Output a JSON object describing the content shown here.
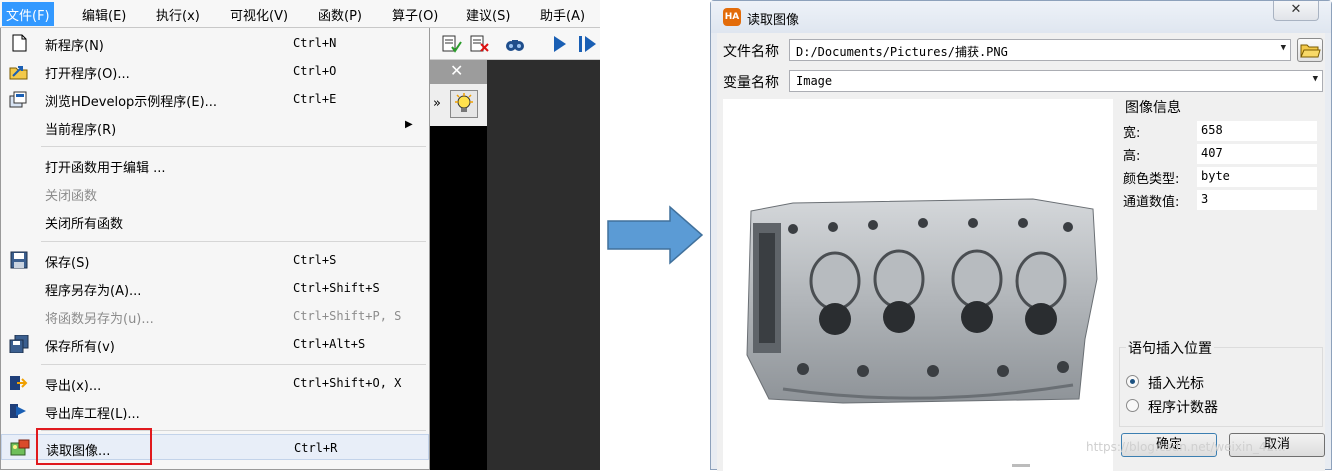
{
  "menubar": {
    "items": [
      "文件(F)",
      "编辑(E)",
      "执行(x)",
      "可视化(V)",
      "函数(P)",
      "算子(O)",
      "建议(S)",
      "助手(A)"
    ]
  },
  "file_menu": {
    "items": [
      {
        "label": "新程序(N)",
        "shortcut": "Ctrl+N",
        "icon": "new-file-icon"
      },
      {
        "label": "打开程序(O)...",
        "shortcut": "Ctrl+O",
        "icon": "open-program-icon"
      },
      {
        "label": "浏览HDevelop示例程序(E)...",
        "shortcut": "Ctrl+E",
        "icon": "browse-examples-icon"
      },
      {
        "label": "当前程序(R)",
        "shortcut": "",
        "icon": ""
      },
      {
        "label": "打开函数用于编辑 ...",
        "shortcut": "",
        "icon": ""
      },
      {
        "label": "关闭函数",
        "shortcut": "",
        "icon": ""
      },
      {
        "label": "关闭所有函数",
        "shortcut": "",
        "icon": ""
      },
      {
        "label": "保存(S)",
        "shortcut": "Ctrl+S",
        "icon": "save-icon"
      },
      {
        "label": "程序另存为(A)...",
        "shortcut": "Ctrl+Shift+S",
        "icon": ""
      },
      {
        "label": "将函数另存为(u)...",
        "shortcut": "Ctrl+Shift+P, S",
        "icon": ""
      },
      {
        "label": "保存所有(v)",
        "shortcut": "Ctrl+Alt+S",
        "icon": "save-all-icon"
      },
      {
        "label": "导出(x)...",
        "shortcut": "Ctrl+Shift+O, X",
        "icon": "export-icon"
      },
      {
        "label": "导出库工程(L)...",
        "shortcut": "",
        "icon": "export-library-icon"
      },
      {
        "label": "读取图像...",
        "shortcut": "Ctrl+R",
        "icon": "read-image-icon"
      }
    ]
  },
  "colors": {
    "highlight": "#e0191e",
    "arrow": "#5b9bd5",
    "menubar_active": "#3399ff"
  },
  "dialog": {
    "title": "读取图像",
    "logo_text": "HA",
    "close_label": "✕",
    "file_name_label": "文件名称",
    "file_name_value": "D:/Documents/Pictures/捕获.PNG",
    "variable_name_label": "变量名称",
    "variable_name_value": "Image",
    "info_title": "图像信息",
    "info": [
      {
        "key": "宽:",
        "value": "658"
      },
      {
        "key": "高:",
        "value": "407"
      },
      {
        "key": "颜色类型:",
        "value": "byte"
      },
      {
        "key": "通道数值:",
        "value": "3"
      }
    ],
    "insert_position_title": "语句插入位置",
    "radio_cursor": "插入光标",
    "radio_counter": "程序计数器",
    "ok_label": "确定",
    "cancel_label": "取消",
    "watermark": "https://blog.csdn.net/weixin_42..."
  }
}
